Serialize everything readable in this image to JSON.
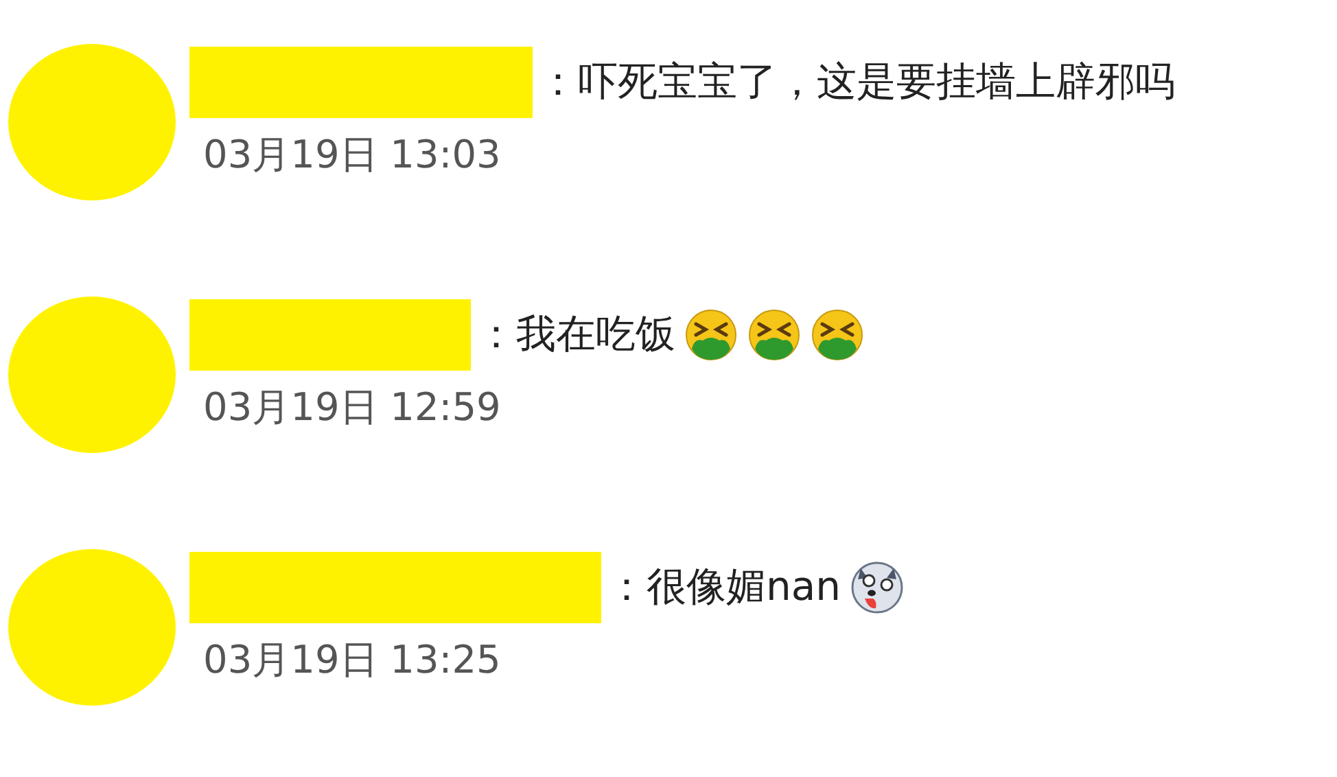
{
  "comments": [
    {
      "text": "：吓死宝宝了，这是要挂墙上辟邪吗",
      "time": "03月19日 13:03"
    },
    {
      "text": "：我在吃饭",
      "emojis": [
        {
          "kind": "vomit"
        },
        {
          "kind": "vomit"
        },
        {
          "kind": "vomit"
        }
      ],
      "time": "03月19日 12:59"
    },
    {
      "text": "：很像媚nan",
      "emojis": [
        {
          "kind": "dog"
        }
      ],
      "time": "03月19日 13:25"
    }
  ]
}
